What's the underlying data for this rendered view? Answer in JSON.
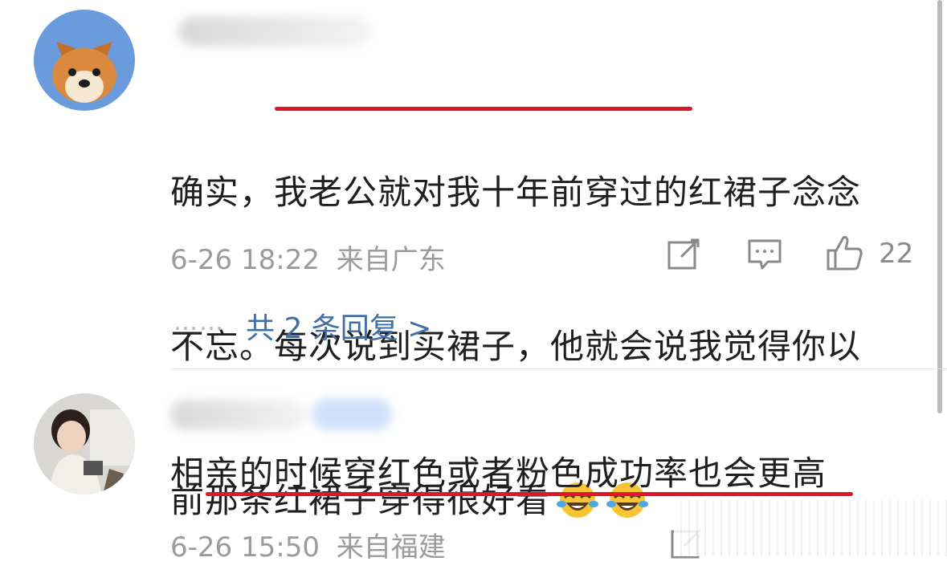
{
  "comments": [
    {
      "text_line1_pre": "确实，",
      "text_line1_underlined": "我老公就对我十年前穿过的",
      "text_line1_post": "红裙子念念",
      "text_line2": "不忘。每次说到买裙子，他就会说我觉得你以",
      "text_line3": "前那条红裙子穿得很好看",
      "emojis": [
        "laughing-tears-icon",
        "laughing-tears-icon"
      ],
      "timestamp": "6-26 18:22",
      "location": "来自广东",
      "like_count": "22",
      "replies_label": "共 2 条回复 >",
      "dots": "……"
    },
    {
      "text": "相亲的时候穿红色或者粉色成功率也会更高",
      "timestamp": "6-26 15:50",
      "location": "来自福建"
    }
  ],
  "colors": {
    "underline": "#e0172a",
    "link": "#3f6fa5",
    "meta": "#9b9b9b"
  }
}
